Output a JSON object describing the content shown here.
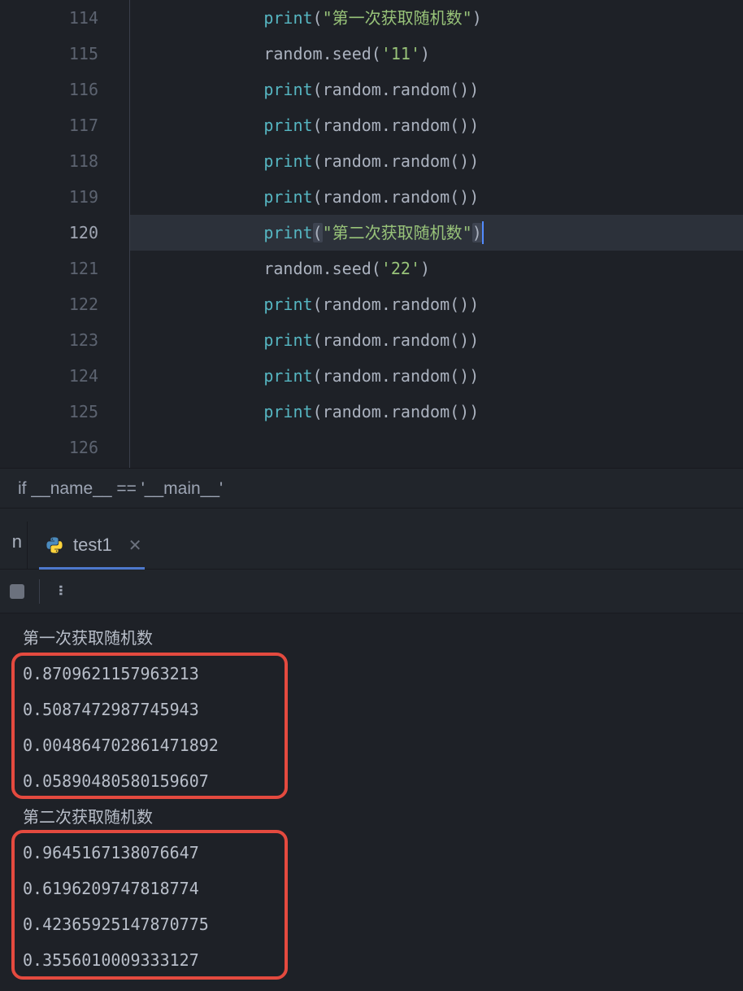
{
  "editor": {
    "current_line_number": 120,
    "lines": [
      {
        "num": 114,
        "indent": "        ",
        "tokens": [
          [
            "fn",
            "print"
          ],
          [
            "punc",
            "("
          ],
          [
            "str",
            "\"第一次获取随机数\""
          ],
          [
            "punc",
            ")"
          ]
        ]
      },
      {
        "num": 115,
        "indent": "        ",
        "tokens": [
          [
            "obj",
            "random.seed("
          ],
          [
            "str",
            "'11'"
          ],
          [
            "obj",
            ")"
          ]
        ]
      },
      {
        "num": 116,
        "indent": "        ",
        "tokens": [
          [
            "fn",
            "print"
          ],
          [
            "punc",
            "(random.random())"
          ]
        ]
      },
      {
        "num": 117,
        "indent": "        ",
        "tokens": [
          [
            "fn",
            "print"
          ],
          [
            "punc",
            "(random.random())"
          ]
        ]
      },
      {
        "num": 118,
        "indent": "        ",
        "tokens": [
          [
            "fn",
            "print"
          ],
          [
            "punc",
            "(random.random())"
          ]
        ]
      },
      {
        "num": 119,
        "indent": "        ",
        "tokens": [
          [
            "fn",
            "print"
          ],
          [
            "punc",
            "(random.random())"
          ]
        ]
      },
      {
        "num": 120,
        "indent": "        ",
        "tokens": [
          [
            "fn",
            "print"
          ],
          [
            "sel",
            "("
          ],
          [
            "str",
            "\"第二次获取随机数\""
          ],
          [
            "sel",
            ")"
          ]
        ],
        "current": true,
        "cursor_after": true
      },
      {
        "num": 121,
        "indent": "        ",
        "tokens": [
          [
            "obj",
            "random.seed("
          ],
          [
            "str",
            "'22'"
          ],
          [
            "obj",
            ")"
          ]
        ]
      },
      {
        "num": 122,
        "indent": "        ",
        "tokens": [
          [
            "fn",
            "print"
          ],
          [
            "punc",
            "(random.random())"
          ]
        ]
      },
      {
        "num": 123,
        "indent": "        ",
        "tokens": [
          [
            "fn",
            "print"
          ],
          [
            "punc",
            "(random.random())"
          ]
        ]
      },
      {
        "num": 124,
        "indent": "        ",
        "tokens": [
          [
            "fn",
            "print"
          ],
          [
            "punc",
            "(random.random())"
          ]
        ]
      },
      {
        "num": 125,
        "indent": "        ",
        "tokens": [
          [
            "fn",
            "print"
          ],
          [
            "punc",
            "(random.random())"
          ]
        ]
      },
      {
        "num": 126,
        "indent": "",
        "tokens": []
      }
    ]
  },
  "breadcrumb": {
    "text": "if __name__ == '__main__'"
  },
  "tabs": {
    "left_fragment": "n",
    "active": {
      "label": "test1",
      "icon": "python-icon"
    }
  },
  "console": {
    "lines": [
      "第一次获取随机数",
      "0.8709621157963213",
      "0.5087472987745943",
      "0.004864702861471892",
      "0.05890480580159607",
      "第二次获取随机数",
      "0.9645167138076647",
      "0.6196209747818774",
      "0.42365925147870775",
      "0.3556010009333127"
    ]
  }
}
